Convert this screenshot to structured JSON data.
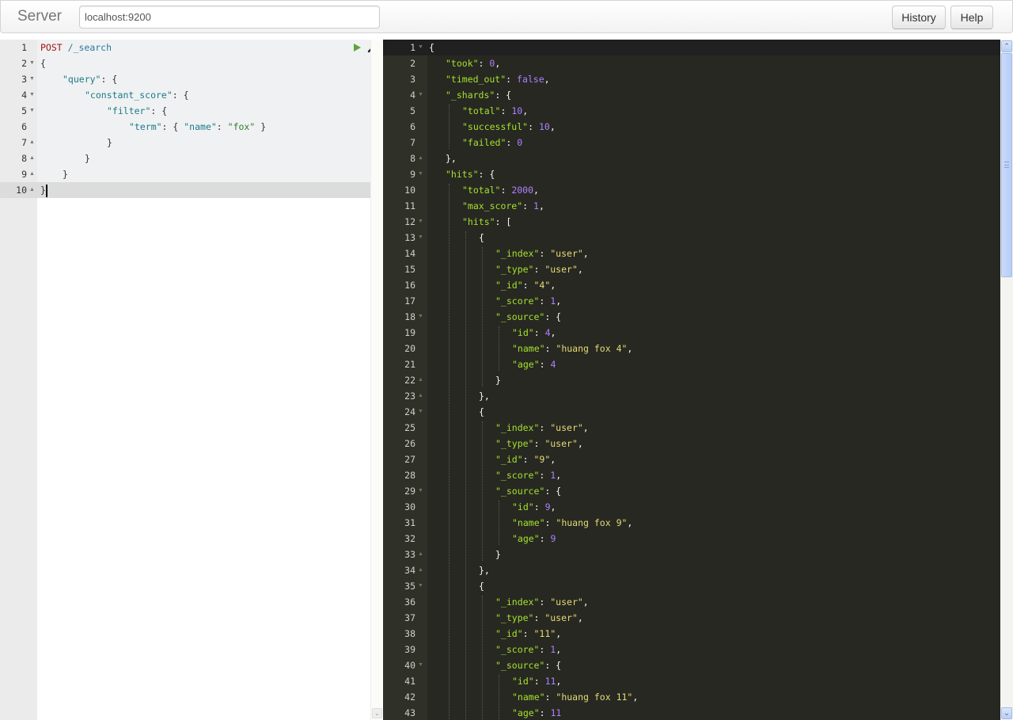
{
  "navbar": {
    "brand": "Server",
    "server_url": "localhost:9200",
    "history_label": "History",
    "help_label": "Help"
  },
  "request_editor": {
    "lines": [
      {
        "n": "1",
        "fold": "",
        "indent": 0,
        "tokens": [
          {
            "t": "POST",
            "c": "k-method"
          },
          {
            "t": " ",
            "c": "k-punct"
          },
          {
            "t": "/_search",
            "c": "k-url"
          }
        ]
      },
      {
        "n": "2",
        "fold": "▼",
        "indent": 0,
        "tokens": [
          {
            "t": "{",
            "c": "k-punct"
          }
        ]
      },
      {
        "n": "3",
        "fold": "▼",
        "indent": 1,
        "tokens": [
          {
            "t": "\"query\"",
            "c": "k-key"
          },
          {
            "t": ": {",
            "c": "k-punct"
          }
        ]
      },
      {
        "n": "4",
        "fold": "▼",
        "indent": 2,
        "tokens": [
          {
            "t": "\"constant_score\"",
            "c": "k-key"
          },
          {
            "t": ": {",
            "c": "k-punct"
          }
        ]
      },
      {
        "n": "5",
        "fold": "▼",
        "indent": 3,
        "tokens": [
          {
            "t": "\"filter\"",
            "c": "k-key"
          },
          {
            "t": ": {",
            "c": "k-punct"
          }
        ]
      },
      {
        "n": "6",
        "fold": "",
        "indent": 4,
        "tokens": [
          {
            "t": "\"term\"",
            "c": "k-key"
          },
          {
            "t": ": { ",
            "c": "k-punct"
          },
          {
            "t": "\"name\"",
            "c": "k-key"
          },
          {
            "t": ": ",
            "c": "k-punct"
          },
          {
            "t": "\"fox\"",
            "c": "k-str"
          },
          {
            "t": " }",
            "c": "k-punct"
          }
        ]
      },
      {
        "n": "7",
        "fold": "▲",
        "indent": 3,
        "tokens": [
          {
            "t": "}",
            "c": "k-punct"
          }
        ]
      },
      {
        "n": "8",
        "fold": "▲",
        "indent": 2,
        "tokens": [
          {
            "t": "}",
            "c": "k-punct"
          }
        ]
      },
      {
        "n": "9",
        "fold": "▲",
        "indent": 1,
        "tokens": [
          {
            "t": "}",
            "c": "k-punct"
          }
        ]
      },
      {
        "n": "10",
        "fold": "▲",
        "indent": 0,
        "tokens": [
          {
            "t": "}",
            "c": "k-punct"
          }
        ]
      }
    ],
    "run_icon": "play-icon",
    "settings_icon": "wrench-icon"
  },
  "response_editor": {
    "lines": [
      {
        "n": "1",
        "fold": "▼",
        "indent": 0,
        "tokens": [
          {
            "t": "{",
            "c": "r-punct"
          }
        ]
      },
      {
        "n": "2",
        "fold": "",
        "indent": 1,
        "tokens": [
          {
            "t": "\"took\"",
            "c": "r-key"
          },
          {
            "t": ": ",
            "c": "r-punct"
          },
          {
            "t": "0",
            "c": "r-num"
          },
          {
            "t": ",",
            "c": "r-punct"
          }
        ]
      },
      {
        "n": "3",
        "fold": "",
        "indent": 1,
        "tokens": [
          {
            "t": "\"timed_out\"",
            "c": "r-key"
          },
          {
            "t": ": ",
            "c": "r-punct"
          },
          {
            "t": "false",
            "c": "r-bool"
          },
          {
            "t": ",",
            "c": "r-punct"
          }
        ]
      },
      {
        "n": "4",
        "fold": "▼",
        "indent": 1,
        "tokens": [
          {
            "t": "\"_shards\"",
            "c": "r-key"
          },
          {
            "t": ": {",
            "c": "r-punct"
          }
        ]
      },
      {
        "n": "5",
        "fold": "",
        "indent": 2,
        "tokens": [
          {
            "t": "\"total\"",
            "c": "r-key"
          },
          {
            "t": ": ",
            "c": "r-punct"
          },
          {
            "t": "10",
            "c": "r-num"
          },
          {
            "t": ",",
            "c": "r-punct"
          }
        ]
      },
      {
        "n": "6",
        "fold": "",
        "indent": 2,
        "tokens": [
          {
            "t": "\"successful\"",
            "c": "r-key"
          },
          {
            "t": ": ",
            "c": "r-punct"
          },
          {
            "t": "10",
            "c": "r-num"
          },
          {
            "t": ",",
            "c": "r-punct"
          }
        ]
      },
      {
        "n": "7",
        "fold": "",
        "indent": 2,
        "tokens": [
          {
            "t": "\"failed\"",
            "c": "r-key"
          },
          {
            "t": ": ",
            "c": "r-punct"
          },
          {
            "t": "0",
            "c": "r-num"
          }
        ]
      },
      {
        "n": "8",
        "fold": "▲",
        "indent": 1,
        "tokens": [
          {
            "t": "},",
            "c": "r-punct"
          }
        ]
      },
      {
        "n": "9",
        "fold": "▼",
        "indent": 1,
        "tokens": [
          {
            "t": "\"hits\"",
            "c": "r-key"
          },
          {
            "t": ": {",
            "c": "r-punct"
          }
        ]
      },
      {
        "n": "10",
        "fold": "",
        "indent": 2,
        "tokens": [
          {
            "t": "\"total\"",
            "c": "r-key"
          },
          {
            "t": ": ",
            "c": "r-punct"
          },
          {
            "t": "2000",
            "c": "r-num"
          },
          {
            "t": ",",
            "c": "r-punct"
          }
        ]
      },
      {
        "n": "11",
        "fold": "",
        "indent": 2,
        "tokens": [
          {
            "t": "\"max_score\"",
            "c": "r-key"
          },
          {
            "t": ": ",
            "c": "r-punct"
          },
          {
            "t": "1",
            "c": "r-num"
          },
          {
            "t": ",",
            "c": "r-punct"
          }
        ]
      },
      {
        "n": "12",
        "fold": "▼",
        "indent": 2,
        "tokens": [
          {
            "t": "\"hits\"",
            "c": "r-key"
          },
          {
            "t": ": [",
            "c": "r-punct"
          }
        ]
      },
      {
        "n": "13",
        "fold": "▼",
        "indent": 3,
        "tokens": [
          {
            "t": "{",
            "c": "r-punct"
          }
        ]
      },
      {
        "n": "14",
        "fold": "",
        "indent": 4,
        "tokens": [
          {
            "t": "\"_index\"",
            "c": "r-key"
          },
          {
            "t": ": ",
            "c": "r-punct"
          },
          {
            "t": "\"user\"",
            "c": "r-str"
          },
          {
            "t": ",",
            "c": "r-punct"
          }
        ]
      },
      {
        "n": "15",
        "fold": "",
        "indent": 4,
        "tokens": [
          {
            "t": "\"_type\"",
            "c": "r-key"
          },
          {
            "t": ": ",
            "c": "r-punct"
          },
          {
            "t": "\"user\"",
            "c": "r-str"
          },
          {
            "t": ",",
            "c": "r-punct"
          }
        ]
      },
      {
        "n": "16",
        "fold": "",
        "indent": 4,
        "tokens": [
          {
            "t": "\"_id\"",
            "c": "r-key"
          },
          {
            "t": ": ",
            "c": "r-punct"
          },
          {
            "t": "\"4\"",
            "c": "r-str"
          },
          {
            "t": ",",
            "c": "r-punct"
          }
        ]
      },
      {
        "n": "17",
        "fold": "",
        "indent": 4,
        "tokens": [
          {
            "t": "\"_score\"",
            "c": "r-key"
          },
          {
            "t": ": ",
            "c": "r-punct"
          },
          {
            "t": "1",
            "c": "r-num"
          },
          {
            "t": ",",
            "c": "r-punct"
          }
        ]
      },
      {
        "n": "18",
        "fold": "▼",
        "indent": 4,
        "tokens": [
          {
            "t": "\"_source\"",
            "c": "r-key"
          },
          {
            "t": ": {",
            "c": "r-punct"
          }
        ]
      },
      {
        "n": "19",
        "fold": "",
        "indent": 5,
        "tokens": [
          {
            "t": "\"id\"",
            "c": "r-key"
          },
          {
            "t": ": ",
            "c": "r-punct"
          },
          {
            "t": "4",
            "c": "r-num"
          },
          {
            "t": ",",
            "c": "r-punct"
          }
        ]
      },
      {
        "n": "20",
        "fold": "",
        "indent": 5,
        "tokens": [
          {
            "t": "\"name\"",
            "c": "r-key"
          },
          {
            "t": ": ",
            "c": "r-punct"
          },
          {
            "t": "\"huang fox 4\"",
            "c": "r-str"
          },
          {
            "t": ",",
            "c": "r-punct"
          }
        ]
      },
      {
        "n": "21",
        "fold": "",
        "indent": 5,
        "tokens": [
          {
            "t": "\"age\"",
            "c": "r-key"
          },
          {
            "t": ": ",
            "c": "r-punct"
          },
          {
            "t": "4",
            "c": "r-num"
          }
        ]
      },
      {
        "n": "22",
        "fold": "▲",
        "indent": 4,
        "tokens": [
          {
            "t": "}",
            "c": "r-punct"
          }
        ]
      },
      {
        "n": "23",
        "fold": "▲",
        "indent": 3,
        "tokens": [
          {
            "t": "},",
            "c": "r-punct"
          }
        ]
      },
      {
        "n": "24",
        "fold": "▼",
        "indent": 3,
        "tokens": [
          {
            "t": "{",
            "c": "r-punct"
          }
        ]
      },
      {
        "n": "25",
        "fold": "",
        "indent": 4,
        "tokens": [
          {
            "t": "\"_index\"",
            "c": "r-key"
          },
          {
            "t": ": ",
            "c": "r-punct"
          },
          {
            "t": "\"user\"",
            "c": "r-str"
          },
          {
            "t": ",",
            "c": "r-punct"
          }
        ]
      },
      {
        "n": "26",
        "fold": "",
        "indent": 4,
        "tokens": [
          {
            "t": "\"_type\"",
            "c": "r-key"
          },
          {
            "t": ": ",
            "c": "r-punct"
          },
          {
            "t": "\"user\"",
            "c": "r-str"
          },
          {
            "t": ",",
            "c": "r-punct"
          }
        ]
      },
      {
        "n": "27",
        "fold": "",
        "indent": 4,
        "tokens": [
          {
            "t": "\"_id\"",
            "c": "r-key"
          },
          {
            "t": ": ",
            "c": "r-punct"
          },
          {
            "t": "\"9\"",
            "c": "r-str"
          },
          {
            "t": ",",
            "c": "r-punct"
          }
        ]
      },
      {
        "n": "28",
        "fold": "",
        "indent": 4,
        "tokens": [
          {
            "t": "\"_score\"",
            "c": "r-key"
          },
          {
            "t": ": ",
            "c": "r-punct"
          },
          {
            "t": "1",
            "c": "r-num"
          },
          {
            "t": ",",
            "c": "r-punct"
          }
        ]
      },
      {
        "n": "29",
        "fold": "▼",
        "indent": 4,
        "tokens": [
          {
            "t": "\"_source\"",
            "c": "r-key"
          },
          {
            "t": ": {",
            "c": "r-punct"
          }
        ]
      },
      {
        "n": "30",
        "fold": "",
        "indent": 5,
        "tokens": [
          {
            "t": "\"id\"",
            "c": "r-key"
          },
          {
            "t": ": ",
            "c": "r-punct"
          },
          {
            "t": "9",
            "c": "r-num"
          },
          {
            "t": ",",
            "c": "r-punct"
          }
        ]
      },
      {
        "n": "31",
        "fold": "",
        "indent": 5,
        "tokens": [
          {
            "t": "\"name\"",
            "c": "r-key"
          },
          {
            "t": ": ",
            "c": "r-punct"
          },
          {
            "t": "\"huang fox 9\"",
            "c": "r-str"
          },
          {
            "t": ",",
            "c": "r-punct"
          }
        ]
      },
      {
        "n": "32",
        "fold": "",
        "indent": 5,
        "tokens": [
          {
            "t": "\"age\"",
            "c": "r-key"
          },
          {
            "t": ": ",
            "c": "r-punct"
          },
          {
            "t": "9",
            "c": "r-num"
          }
        ]
      },
      {
        "n": "33",
        "fold": "▲",
        "indent": 4,
        "tokens": [
          {
            "t": "}",
            "c": "r-punct"
          }
        ]
      },
      {
        "n": "34",
        "fold": "▲",
        "indent": 3,
        "tokens": [
          {
            "t": "},",
            "c": "r-punct"
          }
        ]
      },
      {
        "n": "35",
        "fold": "▼",
        "indent": 3,
        "tokens": [
          {
            "t": "{",
            "c": "r-punct"
          }
        ]
      },
      {
        "n": "36",
        "fold": "",
        "indent": 4,
        "tokens": [
          {
            "t": "\"_index\"",
            "c": "r-key"
          },
          {
            "t": ": ",
            "c": "r-punct"
          },
          {
            "t": "\"user\"",
            "c": "r-str"
          },
          {
            "t": ",",
            "c": "r-punct"
          }
        ]
      },
      {
        "n": "37",
        "fold": "",
        "indent": 4,
        "tokens": [
          {
            "t": "\"_type\"",
            "c": "r-key"
          },
          {
            "t": ": ",
            "c": "r-punct"
          },
          {
            "t": "\"user\"",
            "c": "r-str"
          },
          {
            "t": ",",
            "c": "r-punct"
          }
        ]
      },
      {
        "n": "38",
        "fold": "",
        "indent": 4,
        "tokens": [
          {
            "t": "\"_id\"",
            "c": "r-key"
          },
          {
            "t": ": ",
            "c": "r-punct"
          },
          {
            "t": "\"11\"",
            "c": "r-str"
          },
          {
            "t": ",",
            "c": "r-punct"
          }
        ]
      },
      {
        "n": "39",
        "fold": "",
        "indent": 4,
        "tokens": [
          {
            "t": "\"_score\"",
            "c": "r-key"
          },
          {
            "t": ": ",
            "c": "r-punct"
          },
          {
            "t": "1",
            "c": "r-num"
          },
          {
            "t": ",",
            "c": "r-punct"
          }
        ]
      },
      {
        "n": "40",
        "fold": "▼",
        "indent": 4,
        "tokens": [
          {
            "t": "\"_source\"",
            "c": "r-key"
          },
          {
            "t": ": {",
            "c": "r-punct"
          }
        ]
      },
      {
        "n": "41",
        "fold": "",
        "indent": 5,
        "tokens": [
          {
            "t": "\"id\"",
            "c": "r-key"
          },
          {
            "t": ": ",
            "c": "r-punct"
          },
          {
            "t": "11",
            "c": "r-num"
          },
          {
            "t": ",",
            "c": "r-punct"
          }
        ]
      },
      {
        "n": "42",
        "fold": "",
        "indent": 5,
        "tokens": [
          {
            "t": "\"name\"",
            "c": "r-key"
          },
          {
            "t": ": ",
            "c": "r-punct"
          },
          {
            "t": "\"huang fox 11\"",
            "c": "r-str"
          },
          {
            "t": ",",
            "c": "r-punct"
          }
        ]
      },
      {
        "n": "43",
        "fold": "",
        "indent": 5,
        "tokens": [
          {
            "t": "\"age\"",
            "c": "r-key"
          },
          {
            "t": ": ",
            "c": "r-punct"
          },
          {
            "t": "11",
            "c": "r-num"
          }
        ]
      }
    ]
  },
  "scrollbar": {
    "up_glyph": "⌃",
    "down_glyph": "⌄",
    "scroll_fraction": 0.0
  },
  "colors": {
    "response_bg": "#272822",
    "response_key": "#a6e22e",
    "response_string": "#e6db74",
    "response_number": "#ae81ff",
    "request_method": "#a31515",
    "request_key": "#1b7a8a",
    "run_button": "#5ba43a"
  }
}
